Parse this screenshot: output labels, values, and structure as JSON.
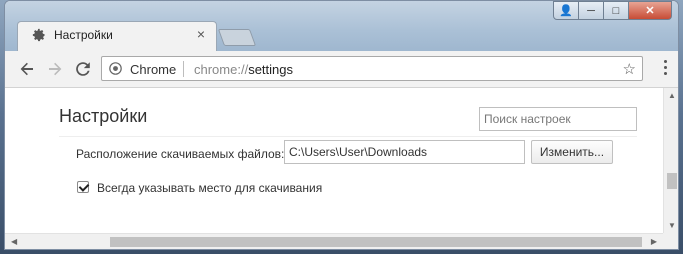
{
  "tab": {
    "title": "Настройки",
    "close": "×"
  },
  "window_controls": {
    "user": "👤",
    "minimize": "─",
    "maximize": "□",
    "close": "✕"
  },
  "toolbar": {
    "chip_label": "Chrome",
    "url_scheme": "chrome://",
    "url_host": "settings"
  },
  "settings": {
    "page_title": "Настройки",
    "search_placeholder": "Поиск настроек",
    "download_location_label": "Расположение скачиваемых файлов:",
    "download_path": "C:\\Users\\User\\Downloads",
    "change_button": "Изменить...",
    "ask_where_label": "Всегда указывать место для скачивания",
    "ask_where_checked": true
  }
}
